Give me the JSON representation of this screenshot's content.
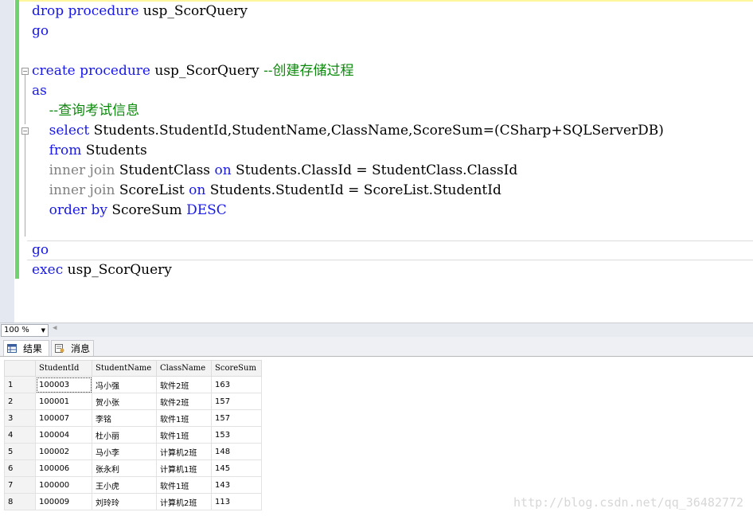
{
  "editor": {
    "lines": [
      [
        [
          "kw",
          "drop procedure"
        ],
        [
          "tx",
          " usp_ScorQuery"
        ]
      ],
      [
        [
          "kw",
          "go"
        ]
      ],
      [],
      [
        [
          "kw",
          "create procedure"
        ],
        [
          "tx",
          " usp_ScorQuery "
        ],
        [
          "cm",
          "--创建存储过程"
        ]
      ],
      [
        [
          "kw",
          "as"
        ]
      ],
      [
        [
          "tx",
          "    "
        ],
        [
          "cm",
          "--查询考试信息"
        ]
      ],
      [
        [
          "tx",
          "    "
        ],
        [
          "kw",
          "select"
        ],
        [
          "tx",
          " Students.StudentId,StudentName,ClassName,ScoreSum=(CSharp+SQLServerDB)"
        ]
      ],
      [
        [
          "tx",
          "    "
        ],
        [
          "kw",
          "from"
        ],
        [
          "tx",
          " Students"
        ]
      ],
      [
        [
          "tx",
          "    "
        ],
        [
          "gr",
          "inner join"
        ],
        [
          "tx",
          " StudentClass "
        ],
        [
          "kw",
          "on"
        ],
        [
          "tx",
          " Students.ClassId = StudentClass.ClassId"
        ]
      ],
      [
        [
          "tx",
          "    "
        ],
        [
          "gr",
          "inner join"
        ],
        [
          "tx",
          " ScoreList "
        ],
        [
          "kw",
          "on"
        ],
        [
          "tx",
          " Students.StudentId = ScoreList.StudentId"
        ]
      ],
      [
        [
          "tx",
          "    "
        ],
        [
          "kw",
          "order by"
        ],
        [
          "tx",
          " ScoreSum "
        ],
        [
          "kw",
          "DESC"
        ]
      ],
      [],
      [
        [
          "kw",
          "go"
        ]
      ],
      [
        [
          "kw",
          "exec"
        ],
        [
          "tx",
          " usp_ScorQuery"
        ]
      ]
    ]
  },
  "zoom": {
    "value": "100 %"
  },
  "tabs": {
    "results": "结果",
    "messages": "消息"
  },
  "grid": {
    "columns": [
      "StudentId",
      "StudentName",
      "ClassName",
      "ScoreSum"
    ],
    "rows": [
      [
        "1",
        "100003",
        "冯小强",
        "软件2班",
        "163"
      ],
      [
        "2",
        "100001",
        "贺小张",
        "软件2班",
        "157"
      ],
      [
        "3",
        "100007",
        "李铭",
        "软件1班",
        "157"
      ],
      [
        "4",
        "100004",
        "杜小丽",
        "软件1班",
        "153"
      ],
      [
        "5",
        "100002",
        "马小李",
        "计算机2班",
        "148"
      ],
      [
        "6",
        "100006",
        "张永利",
        "计算机1班",
        "145"
      ],
      [
        "7",
        "100000",
        "王小虎",
        "软件1班",
        "143"
      ],
      [
        "8",
        "100009",
        "刘玲玲",
        "计算机2班",
        "113"
      ]
    ]
  },
  "watermark": "http://blog.csdn.net/qq_36482772",
  "colors": {
    "keyword": "#1818e8",
    "comment": "#0a8a0a",
    "join": "#808080",
    "changebar": "#6fd36f"
  }
}
